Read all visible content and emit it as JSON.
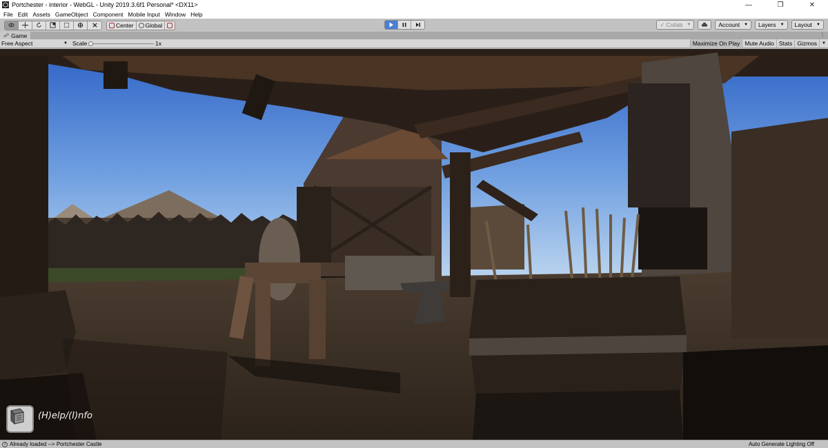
{
  "window": {
    "title": "Portchester - interior - WebGL - Unity 2019.3.6f1 Personal* <DX11>",
    "controls": {
      "minimize": "—",
      "restore": "❐",
      "close": "✕"
    }
  },
  "menu": [
    "File",
    "Edit",
    "Assets",
    "GameObject",
    "Component",
    "Mobile Input",
    "Window",
    "Help"
  ],
  "toolbar": {
    "tools": [
      "hand-icon",
      "move-icon",
      "rotate-icon",
      "scale-icon",
      "rect-icon",
      "transform-icon",
      "custom-tool-icon"
    ],
    "pivot_label": "Center",
    "space_label": "Global",
    "collab_label": "Collab",
    "account_label": "Account",
    "layers_label": "Layers",
    "layout_label": "Layout"
  },
  "game_tab": {
    "label": "Game"
  },
  "game_bar": {
    "aspect": "Free Aspect",
    "scale_label": "Scale",
    "scale_value": "1x",
    "maximize_label": "Maximize On Play",
    "mute_label": "Mute Audio",
    "stats_label": "Stats",
    "gizmos_label": "Gizmos"
  },
  "viewport": {
    "help_text": "(H)elp/(I)nfo"
  },
  "status": {
    "message": "Already loaded --> Portchester Castle",
    "right": "Auto Generate Lighting Off"
  },
  "colors": {
    "play_active": "#4a7fd4",
    "sky_top": "#3a6fd0",
    "sky_bottom": "#9ec2ec",
    "ground": "#3d3127"
  }
}
